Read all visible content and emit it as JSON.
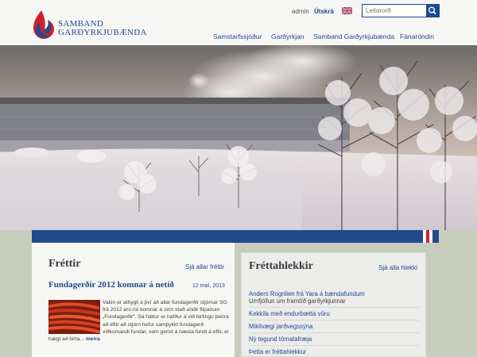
{
  "brand": {
    "line1": "SAMBAND",
    "line2": "GARÐYRKJUBÆNDA",
    "colors": {
      "blue": "#1f4a8e",
      "red": "#d0202c"
    }
  },
  "utility": {
    "admin": "admin",
    "print": "Útskrá",
    "flag_icon": "uk-flag-icon"
  },
  "search": {
    "placeholder": "Leitarorð",
    "icon": "search-icon"
  },
  "nav": [
    "Samstarfssjóður",
    "Garðyrkjan",
    "Samband Garðyrkjubænda",
    "Fánaröndin"
  ],
  "news": {
    "title": "Fréttir",
    "all_link": "Sjá allar fréttir",
    "article": {
      "title": "Fundagerðir 2012 komnar á netið",
      "date": "12 maí, 2013",
      "body": "Vakin er athygli á því að allar fundagerðir stjórnar SG frá 2012 eru nú komnar á sinn stað undir flipanum „Fundagerðir“. Sá háttur er hafður á við birtingu þeirra að eftir að stjórn hefur samþykkt fundagerð viðkomandi fundar, sem gerist á næsta fundi á eftir, er hægt að birta...",
      "more": "meira"
    }
  },
  "news_links": {
    "title": "Fréttahlekkir",
    "all_link": "Sjá alla hlekki",
    "items": [
      {
        "label": "Anders Rognlien frá Yara á bændafundum",
        "sub": "Umfjöllun um framtíð garðyrkjunnar"
      },
      {
        "label": "Kekkila með endurbætta vöru"
      },
      {
        "label": "Mikilvægi jarðvegssýna"
      },
      {
        "label": "Ný tegund tómatafræja"
      },
      {
        "label": "Þetta er fréttahlekkur"
      }
    ]
  }
}
